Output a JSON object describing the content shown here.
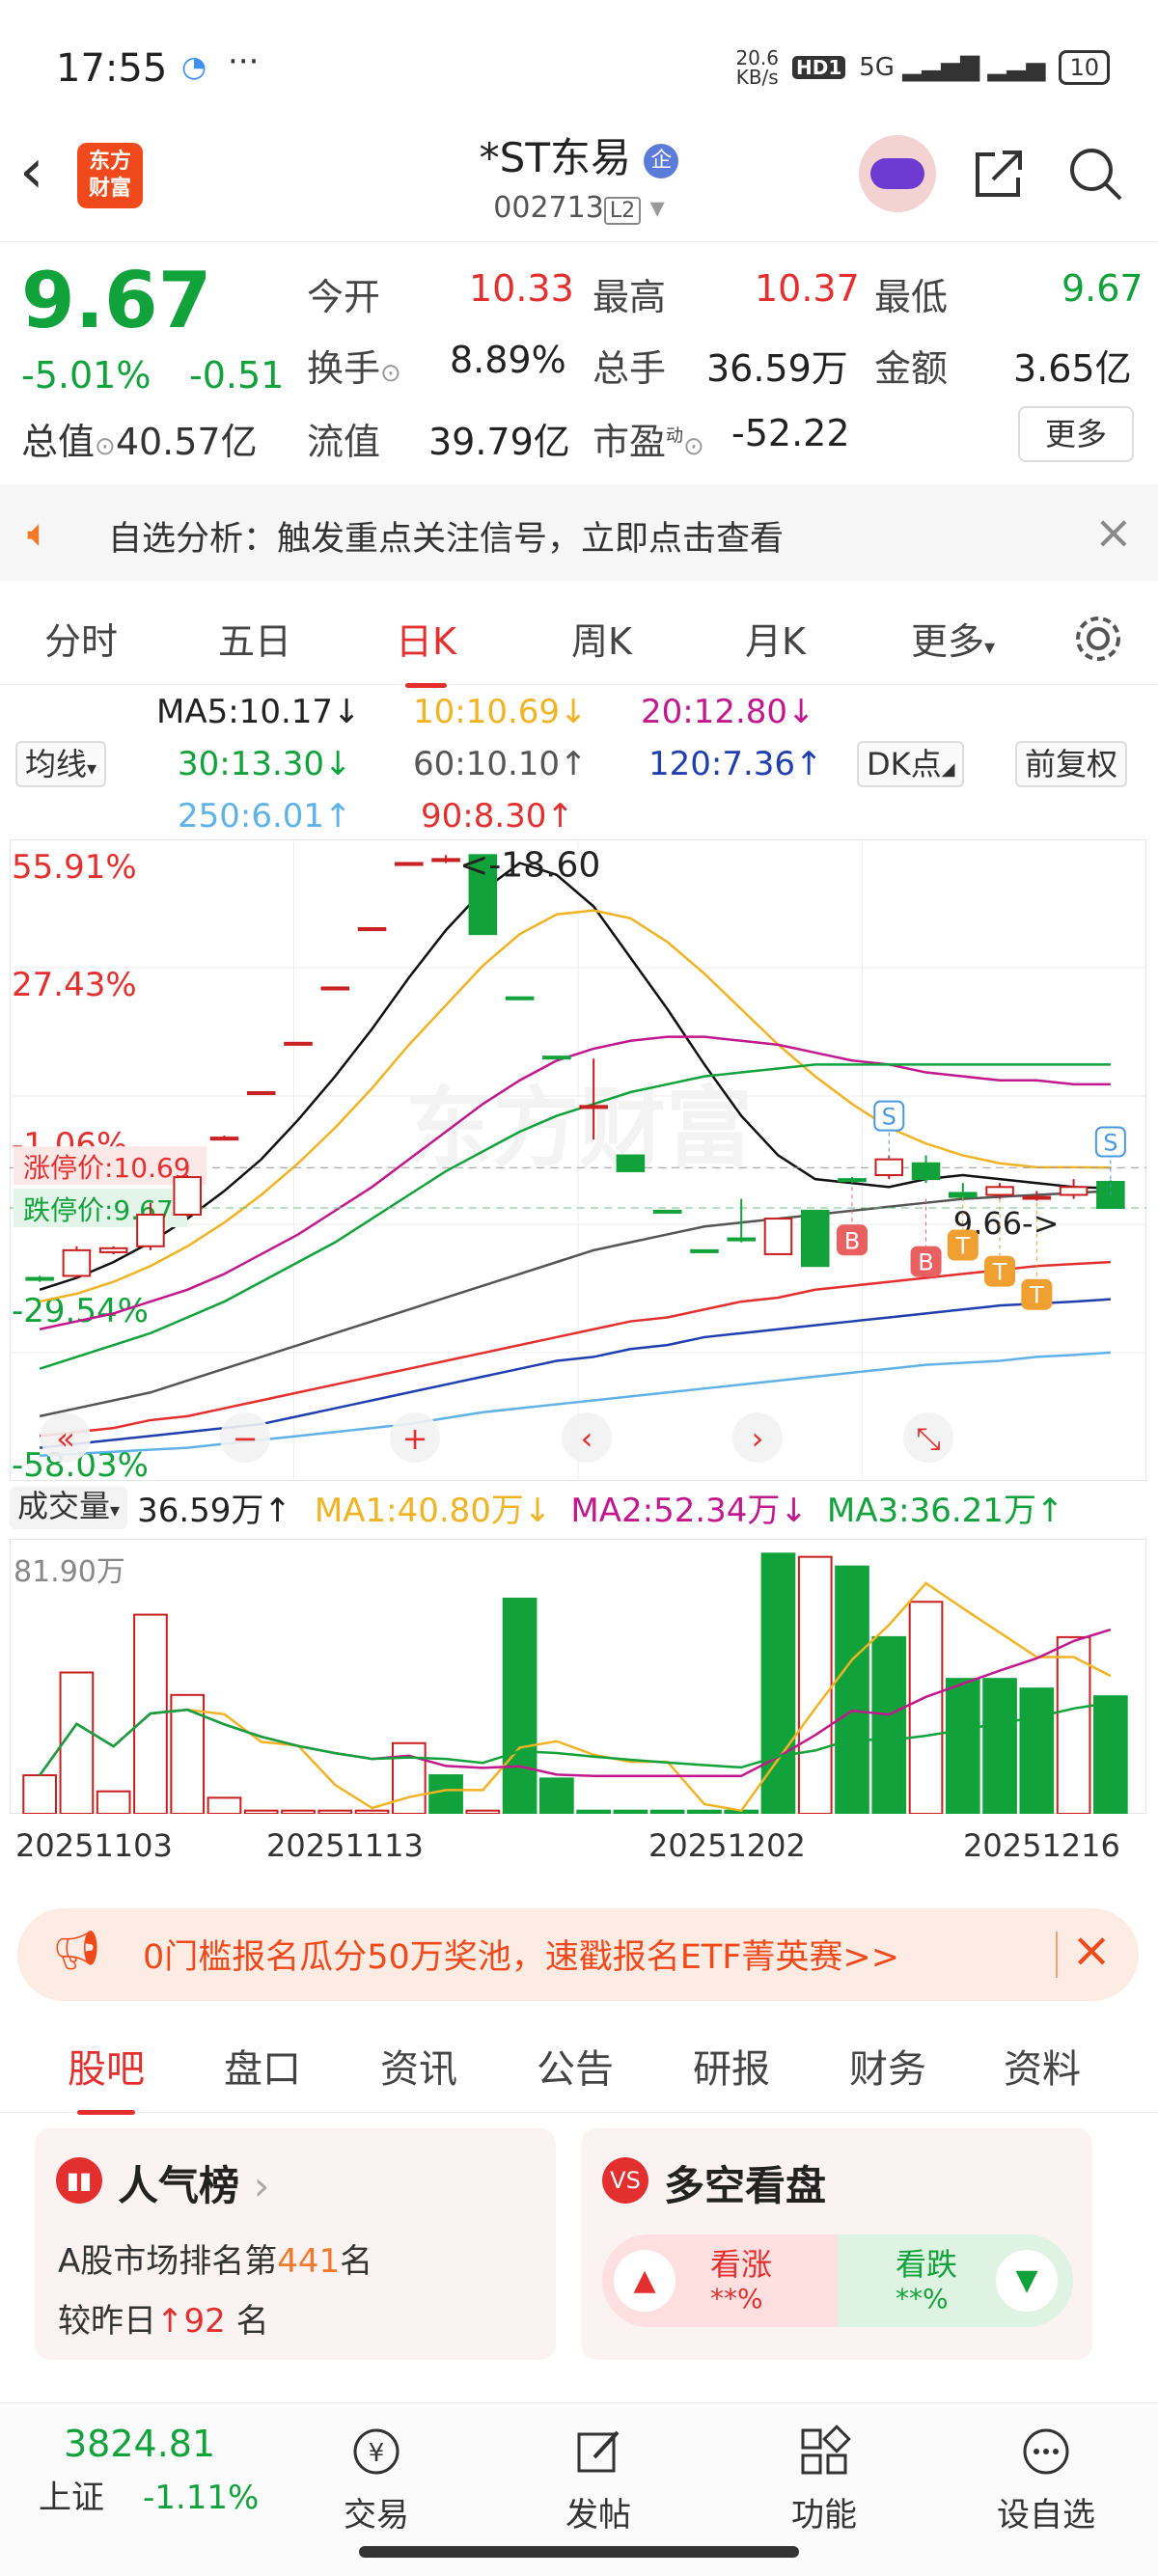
{
  "status": {
    "time": "17:55",
    "net_speed_top": "20.6",
    "net_speed_unit": "KB/s",
    "hd": "HD1",
    "net": "5G",
    "battery": "10"
  },
  "header": {
    "logo_text": "东方\n财富",
    "name": "*ST东易",
    "badge": "企",
    "code": "002713",
    "level": "L2"
  },
  "quote": {
    "price": "9.67",
    "pct": "-5.01%",
    "chg": "-0.51",
    "open_label": "今开",
    "open": "10.33",
    "high_label": "最高",
    "high": "10.37",
    "low_label": "最低",
    "low": "9.67",
    "turnover_label": "换手",
    "turnover": "8.89%",
    "vol_label": "总手",
    "vol": "36.59万",
    "amount_label": "金额",
    "amount": "3.65亿",
    "mktcap_label": "总值",
    "mktcap": "40.57亿",
    "float_label": "流值",
    "float": "39.79亿",
    "pe_label": "市盈",
    "pe_sup": "动",
    "pe": "-52.22",
    "more": "更多"
  },
  "alert": {
    "text": "自选分析：触发重点关注信号，立即点击查看"
  },
  "ktabs": [
    "分时",
    "五日",
    "日K",
    "周K",
    "月K",
    "更多"
  ],
  "ktab_active": "日K",
  "ma_legend": {
    "indicator": "均线",
    "ma5": "MA5:10.17↓",
    "ma10": "10:10.69↓",
    "ma20": "20:12.80↓",
    "ma30": "30:13.30↓",
    "ma60": "60:10.10↑",
    "ma120": "120:7.36↑",
    "ma250": "250:6.01↑",
    "ma90": "90:8.30↑",
    "dk": "DK点",
    "fq": "前复权"
  },
  "chart_data": [
    {
      "type": "candlestick",
      "title": "",
      "y_ticks": [
        "55.91%",
        "27.43%",
        "-1.06%",
        "-29.54%",
        "-58.03%"
      ],
      "labels": {
        "limit_up": "涨停价:10.69",
        "limit_down": "跌停价:9.67",
        "max_note": "<-18.60",
        "last_note": "9.66->"
      },
      "markers": [
        "S",
        "S",
        "B",
        "B",
        "T",
        "T",
        "T"
      ],
      "candles": [
        {
          "o": 7.9,
          "c": 7.85,
          "h": 7.95,
          "l": 7.8
        },
        {
          "o": 7.95,
          "c": 8.6,
          "h": 8.7,
          "l": 7.9
        },
        {
          "o": 8.55,
          "c": 8.65,
          "h": 8.7,
          "l": 8.5
        },
        {
          "o": 8.7,
          "c": 9.5,
          "h": 9.8,
          "l": 8.6
        },
        {
          "o": 9.5,
          "c": 10.45,
          "h": 10.5,
          "l": 9.45
        },
        {
          "o": 11.4,
          "c": 11.45,
          "h": 11.5,
          "l": 11.4
        },
        {
          "o": 12.55,
          "c": 12.6,
          "h": 12.6,
          "l": 12.55
        },
        {
          "o": 13.8,
          "c": 13.85,
          "h": 13.85,
          "l": 13.8
        },
        {
          "o": 15.2,
          "c": 15.25,
          "h": 15.25,
          "l": 15.2
        },
        {
          "o": 16.7,
          "c": 16.75,
          "h": 16.75,
          "l": 16.7
        },
        {
          "o": 18.35,
          "c": 18.4,
          "h": 18.4,
          "l": 18.35
        },
        {
          "o": 18.45,
          "c": 18.5,
          "h": 18.6,
          "l": 18.4
        },
        {
          "o": 18.6,
          "c": 16.6,
          "h": 18.6,
          "l": 16.6
        },
        {
          "o": 15.0,
          "c": 14.95,
          "h": 15.0,
          "l": 14.95
        },
        {
          "o": 13.5,
          "c": 13.45,
          "h": 13.5,
          "l": 13.45
        },
        {
          "o": 12.2,
          "c": 12.25,
          "h": 13.45,
          "l": 11.4
        },
        {
          "o": 11.0,
          "c": 10.6,
          "h": 11.0,
          "l": 10.6
        },
        {
          "o": 9.6,
          "c": 9.55,
          "h": 9.6,
          "l": 9.55
        },
        {
          "o": 8.6,
          "c": 8.55,
          "h": 8.6,
          "l": 8.55
        },
        {
          "o": 8.9,
          "c": 8.85,
          "h": 9.9,
          "l": 8.8
        },
        {
          "o": 8.5,
          "c": 9.4,
          "h": 9.4,
          "l": 8.5
        },
        {
          "o": 9.6,
          "c": 8.2,
          "h": 9.6,
          "l": 8.2
        },
        {
          "o": 10.4,
          "c": 10.35,
          "h": 10.45,
          "l": 10.3
        },
        {
          "o": 10.5,
          "c": 10.9,
          "h": 11.0,
          "l": 10.4
        },
        {
          "o": 10.8,
          "c": 10.4,
          "h": 11.0,
          "l": 10.3
        },
        {
          "o": 10.05,
          "c": 9.95,
          "h": 10.3,
          "l": 9.85
        },
        {
          "o": 10.0,
          "c": 10.2,
          "h": 10.3,
          "l": 9.9
        },
        {
          "o": 9.95,
          "c": 9.95,
          "h": 10.1,
          "l": 9.85
        },
        {
          "o": 10.0,
          "c": 10.2,
          "h": 10.4,
          "l": 9.9
        },
        {
          "o": 10.33,
          "c": 9.67,
          "h": 10.37,
          "l": 9.67
        }
      ],
      "ma_lines": {
        "MA5": [
          7.6,
          7.9,
          8.3,
          8.8,
          9.4,
          10.1,
          10.9,
          11.9,
          13.0,
          14.2,
          15.5,
          16.7,
          17.7,
          18.4,
          18.1,
          17.3,
          16.0,
          14.7,
          13.3,
          12.0,
          11.0,
          10.4,
          10.3,
          10.2,
          10.4,
          10.5,
          10.4,
          10.3,
          10.2,
          10.17
        ],
        "MA10": [
          7.3,
          7.5,
          7.8,
          8.2,
          8.7,
          9.3,
          10.0,
          10.8,
          11.7,
          12.7,
          13.8,
          14.8,
          15.8,
          16.6,
          17.1,
          17.2,
          17.0,
          16.4,
          15.6,
          14.7,
          13.8,
          13.0,
          12.3,
          11.7,
          11.3,
          11.0,
          10.8,
          10.7,
          10.7,
          10.69
        ],
        "MA20": [
          6.6,
          6.8,
          7.0,
          7.3,
          7.6,
          8.0,
          8.5,
          9.0,
          9.6,
          10.2,
          10.9,
          11.6,
          12.3,
          12.9,
          13.4,
          13.7,
          13.9,
          14.0,
          14.0,
          13.9,
          13.8,
          13.6,
          13.4,
          13.3,
          13.1,
          13.0,
          12.9,
          12.9,
          12.8,
          12.8
        ],
        "MA30": [
          5.6,
          5.9,
          6.2,
          6.5,
          6.9,
          7.3,
          7.8,
          8.3,
          8.8,
          9.4,
          10.0,
          10.6,
          11.1,
          11.6,
          12.0,
          12.3,
          12.6,
          12.8,
          13.0,
          13.1,
          13.2,
          13.3,
          13.3,
          13.3,
          13.3,
          13.3,
          13.3,
          13.3,
          13.3,
          13.3
        ],
        "MA60": [
          4.4,
          4.6,
          4.8,
          5.0,
          5.3,
          5.6,
          5.9,
          6.2,
          6.5,
          6.8,
          7.1,
          7.4,
          7.7,
          8.0,
          8.3,
          8.6,
          8.8,
          9.0,
          9.2,
          9.3,
          9.4,
          9.5,
          9.6,
          9.7,
          9.8,
          9.9,
          9.95,
          10.0,
          10.05,
          10.1
        ],
        "MA90": [
          3.9,
          4.0,
          4.1,
          4.3,
          4.4,
          4.6,
          4.8,
          5.0,
          5.2,
          5.4,
          5.6,
          5.8,
          6.0,
          6.2,
          6.4,
          6.6,
          6.8,
          6.9,
          7.1,
          7.3,
          7.4,
          7.6,
          7.7,
          7.8,
          7.9,
          8.0,
          8.1,
          8.2,
          8.25,
          8.3
        ],
        "MA120": [
          3.6,
          3.7,
          3.8,
          3.9,
          4.0,
          4.1,
          4.2,
          4.4,
          4.6,
          4.8,
          5.0,
          5.2,
          5.4,
          5.6,
          5.8,
          5.9,
          6.1,
          6.2,
          6.4,
          6.5,
          6.6,
          6.7,
          6.8,
          6.9,
          7.0,
          7.1,
          7.2,
          7.25,
          7.3,
          7.36
        ],
        "MA250": [
          3.4,
          3.45,
          3.5,
          3.55,
          3.6,
          3.7,
          3.8,
          3.9,
          4.0,
          4.1,
          4.2,
          4.35,
          4.5,
          4.6,
          4.7,
          4.8,
          4.9,
          5.0,
          5.1,
          5.2,
          5.3,
          5.4,
          5.5,
          5.6,
          5.7,
          5.75,
          5.8,
          5.9,
          5.95,
          6.01
        ]
      },
      "ylim": [
        3.2,
        18.9
      ]
    },
    {
      "type": "bar",
      "title": "成交量",
      "unit": "万",
      "max_label": "81.90万",
      "values": [
        12,
        44,
        7,
        62,
        37,
        5,
        1,
        1,
        1,
        1,
        22,
        12,
        1,
        67,
        11,
        1,
        1,
        1,
        1,
        1,
        81,
        80,
        77,
        55,
        66,
        42,
        42,
        39,
        55,
        36.59
      ],
      "up": [
        true,
        true,
        true,
        true,
        true,
        true,
        true,
        true,
        true,
        true,
        true,
        false,
        true,
        false,
        false,
        false,
        false,
        false,
        false,
        false,
        false,
        true,
        false,
        false,
        true,
        false,
        false,
        false,
        true,
        false
      ],
      "ylim": [
        0,
        82
      ]
    }
  ],
  "vol_legend": {
    "indicator": "成交量",
    "vol": "36.59万↑",
    "ma1": "MA1:40.80万↓",
    "ma2": "MA2:52.34万↓",
    "ma3": "MA3:36.21万↑"
  },
  "dates": [
    "20251103",
    "20251113",
    "20251202",
    "20251216"
  ],
  "banner": {
    "text": "0门槛报名瓜分50万奖池，速戳报名ETF菁英赛>>"
  },
  "btabs": [
    "股吧",
    "盘口",
    "资讯",
    "公告",
    "研报",
    "财务",
    "资料"
  ],
  "cards": {
    "popularity": {
      "title": "人气榜",
      "line1_pre": "A股市场排名第",
      "rank": "441",
      "line1_post": "名",
      "line2_pre": "较昨日",
      "delta": "92",
      "line2_post": "名"
    },
    "vote": {
      "title": "多空看盘",
      "up": "看涨",
      "up_val": "**%",
      "down": "看跌",
      "down_val": "**%"
    }
  },
  "footer": {
    "index_value": "3824.81",
    "index_name": "上证",
    "index_pct": "-1.11%",
    "trade": "交易",
    "post": "发帖",
    "func": "功能",
    "add": "设自选"
  }
}
